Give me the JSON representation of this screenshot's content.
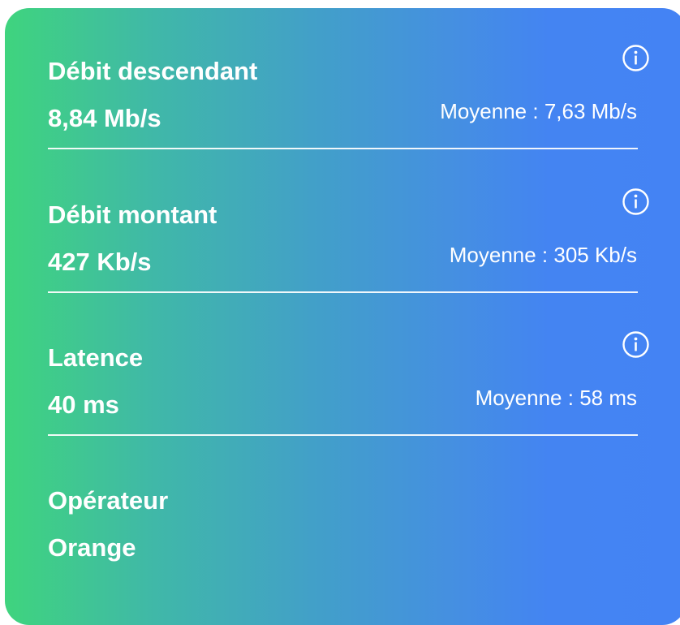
{
  "metrics": [
    {
      "label": "Débit descendant",
      "value": "8,84 Mb/s",
      "average": "Moyenne : 7,63 Mb/s",
      "info_icon": "info-icon"
    },
    {
      "label": "Débit montant",
      "value": "427 Kb/s",
      "average": "Moyenne : 305 Kb/s",
      "info_icon": "info-icon"
    },
    {
      "label": "Latence",
      "value": "40 ms",
      "average": "Moyenne : 58 ms",
      "info_icon": "info-icon"
    }
  ],
  "operator": {
    "label": "Opérateur",
    "value": "Orange"
  },
  "colors": {
    "gradient_start": "#3fd47e",
    "gradient_end": "#4483f4",
    "text": "#ffffff"
  }
}
